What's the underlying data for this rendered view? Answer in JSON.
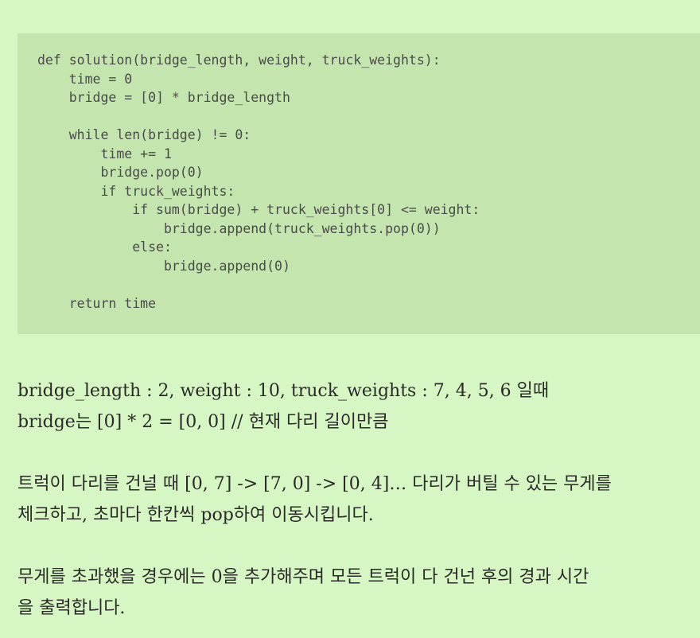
{
  "code": {
    "lines": [
      "def solution(bridge_length, weight, truck_weights):",
      "    time = 0",
      "    bridge = [0] * bridge_length",
      "",
      "    while len(bridge) != 0:",
      "        time += 1",
      "        bridge.pop(0)",
      "        if truck_weights:",
      "            if sum(bridge) + truck_weights[0] <= weight:",
      "                bridge.append(truck_weights.pop(0))",
      "            else:",
      "                bridge.append(0)",
      "",
      "    return time"
    ]
  },
  "prose": {
    "line1": "bridge_length : 2, weight : 10, truck_weights : 7, 4, 5, 6 일때",
    "line2": "bridge는 [0] * 2 = [0, 0] // 현재 다리 길이만큼",
    "line3": "트럭이 다리를 건널 때 [0, 7] -> [7, 0] -> [0, 4]… 다리가 버틸 수 있는 무게를",
    "line4": "체크하고, 초마다 한칸씩 pop하여 이동시킵니다.",
    "line5": "무게를 초과했을 경우에는 0을 추가해주며 모든 트럭이 다 건넌 후의 경과 시간",
    "line6": "을 출력합니다."
  }
}
